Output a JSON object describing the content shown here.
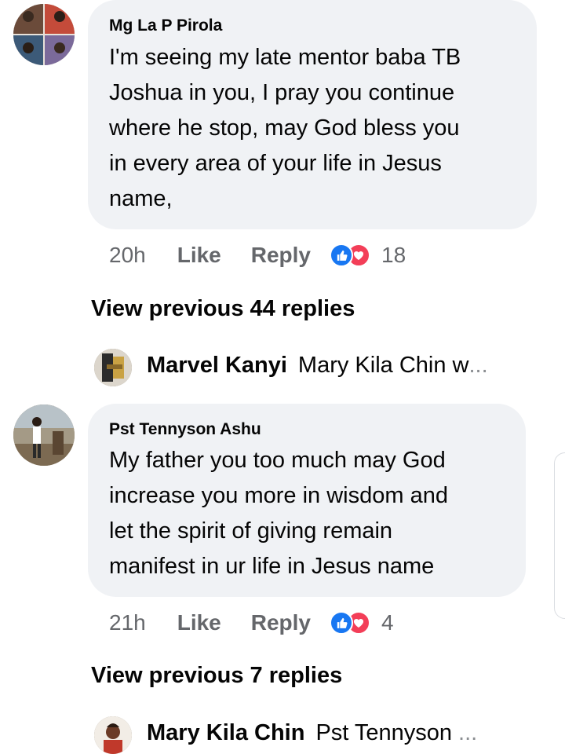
{
  "comments": [
    {
      "author": "Mg La P Pirola",
      "text_lines": [
        "I'm seeing my late mentor baba TB",
        "Joshua in you, I pray you continue",
        "where he stop, may God bless you",
        "in every area of your life in Jesus",
        "name,"
      ],
      "time": "20h",
      "like_label": "Like",
      "reply_label": "Reply",
      "reaction_count": "18",
      "view_previous": "View previous 44 replies",
      "latest_reply": {
        "name": "Marvel Kanyi",
        "text": "Mary Kila Chin w",
        "ellipsis": "..."
      }
    },
    {
      "author": "Pst Tennyson Ashu",
      "text_lines": [
        "My father you too much may God",
        "increase you more in wisdom and",
        "let the spirit of giving remain",
        "manifest in ur life in Jesus name"
      ],
      "time": "21h",
      "like_label": "Like",
      "reply_label": "Reply",
      "reaction_count": "4",
      "view_previous": "View previous 7 replies",
      "latest_reply": {
        "name": "Mary Kila Chin",
        "text": "Pst Tennyson",
        "ellipsis": "..."
      }
    }
  ],
  "icons": {
    "like_reaction": "thumbs-up-icon",
    "love_reaction": "heart-icon"
  },
  "colors": {
    "bubble_bg": "#f0f2f5",
    "meta_text": "#65676b",
    "like_blue": "#1877f2",
    "love_red": "#f33e58"
  }
}
